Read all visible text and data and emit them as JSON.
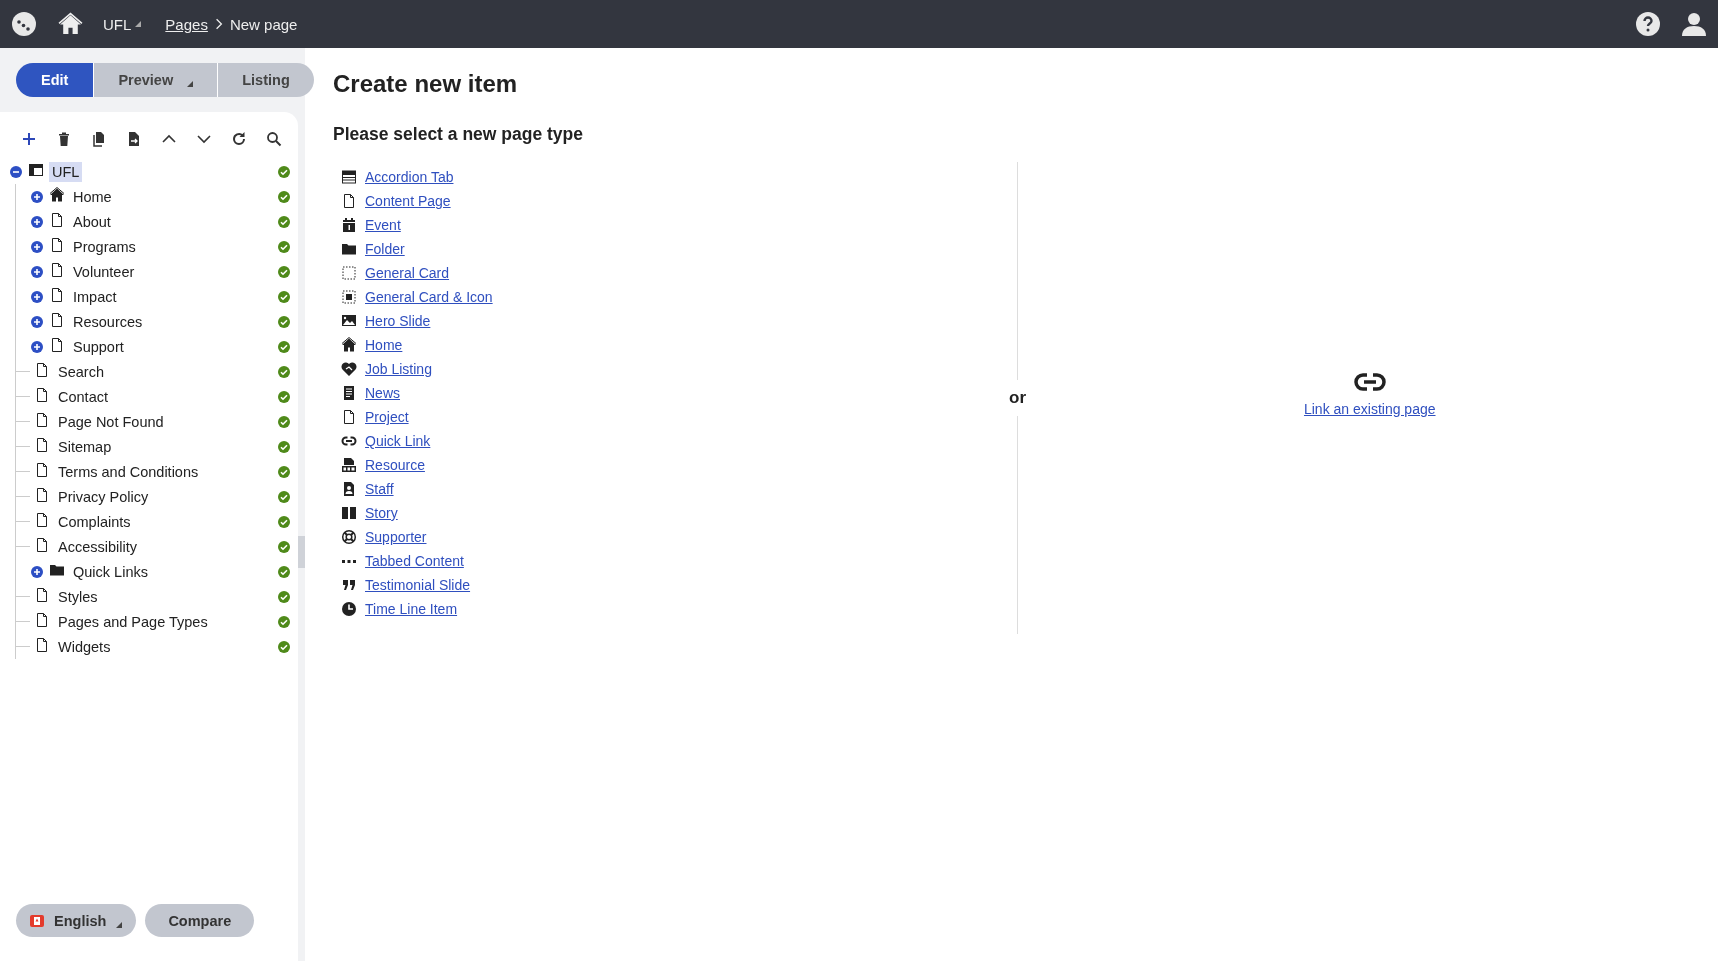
{
  "topbar": {
    "site": "UFL",
    "breadcrumb": [
      {
        "label": "Pages",
        "link": true
      },
      {
        "label": "New page",
        "link": false
      }
    ]
  },
  "mode_tabs": [
    {
      "label": "Edit",
      "selected": true,
      "dropdown": false
    },
    {
      "label": "Preview",
      "selected": false,
      "dropdown": true
    },
    {
      "label": "Listing",
      "selected": false,
      "dropdown": false
    }
  ],
  "tree": {
    "label": "UFL",
    "kind": "site",
    "expanded": true,
    "selected": true,
    "published": true,
    "children": [
      {
        "label": "Home",
        "kind": "home",
        "expandable": true,
        "expanded": false,
        "selected": false,
        "published": true
      },
      {
        "label": "About",
        "kind": "page",
        "expandable": true,
        "expanded": false,
        "selected": false,
        "published": true
      },
      {
        "label": "Programs",
        "kind": "page",
        "expandable": true,
        "expanded": false,
        "selected": false,
        "published": true
      },
      {
        "label": "Volunteer",
        "kind": "page",
        "expandable": true,
        "expanded": false,
        "selected": false,
        "published": true
      },
      {
        "label": "Impact",
        "kind": "page",
        "expandable": true,
        "expanded": false,
        "selected": false,
        "published": true
      },
      {
        "label": "Resources",
        "kind": "page",
        "expandable": true,
        "expanded": false,
        "selected": false,
        "published": true
      },
      {
        "label": "Support",
        "kind": "page",
        "expandable": true,
        "expanded": false,
        "selected": false,
        "published": true
      },
      {
        "label": "Search",
        "kind": "page",
        "expandable": false,
        "expanded": false,
        "selected": false,
        "published": true
      },
      {
        "label": "Contact",
        "kind": "page",
        "expandable": false,
        "expanded": false,
        "selected": false,
        "published": true
      },
      {
        "label": "Page Not Found",
        "kind": "page",
        "expandable": false,
        "expanded": false,
        "selected": false,
        "published": true
      },
      {
        "label": "Sitemap",
        "kind": "page",
        "expandable": false,
        "expanded": false,
        "selected": false,
        "published": true
      },
      {
        "label": "Terms and Conditions",
        "kind": "page",
        "expandable": false,
        "expanded": false,
        "selected": false,
        "published": true
      },
      {
        "label": "Privacy Policy",
        "kind": "page",
        "expandable": false,
        "expanded": false,
        "selected": false,
        "published": true
      },
      {
        "label": "Complaints",
        "kind": "page",
        "expandable": false,
        "expanded": false,
        "selected": false,
        "published": true
      },
      {
        "label": "Accessibility",
        "kind": "page",
        "expandable": false,
        "expanded": false,
        "selected": false,
        "published": true
      },
      {
        "label": "Quick Links",
        "kind": "folder",
        "expandable": true,
        "expanded": false,
        "selected": false,
        "published": true
      },
      {
        "label": "Styles",
        "kind": "page",
        "expandable": false,
        "expanded": false,
        "selected": false,
        "published": true
      },
      {
        "label": "Pages and Page Types",
        "kind": "page",
        "expandable": false,
        "expanded": false,
        "selected": false,
        "published": true
      },
      {
        "label": "Widgets",
        "kind": "page",
        "expandable": false,
        "expanded": false,
        "selected": false,
        "published": true
      }
    ]
  },
  "footer": {
    "language": "English",
    "compare": "Compare"
  },
  "main": {
    "title": "Create new item",
    "subtitle": "Please select a new page type",
    "page_types": [
      {
        "label": "Accordion Tab",
        "kind": "accordion"
      },
      {
        "label": "Content Page",
        "kind": "page"
      },
      {
        "label": "Event",
        "kind": "event"
      },
      {
        "label": "Folder",
        "kind": "folder"
      },
      {
        "label": "General Card",
        "kind": "card"
      },
      {
        "label": "General Card & Icon",
        "kind": "card_icon"
      },
      {
        "label": "Hero Slide",
        "kind": "image"
      },
      {
        "label": "Home",
        "kind": "home"
      },
      {
        "label": "Job Listing",
        "kind": "heart"
      },
      {
        "label": "News",
        "kind": "news"
      },
      {
        "label": "Project",
        "kind": "page"
      },
      {
        "label": "Quick Link",
        "kind": "link"
      },
      {
        "label": "Resource",
        "kind": "pdf"
      },
      {
        "label": "Staff",
        "kind": "staff"
      },
      {
        "label": "Story",
        "kind": "book"
      },
      {
        "label": "Supporter",
        "kind": "lifering"
      },
      {
        "label": "Tabbed Content",
        "kind": "dots"
      },
      {
        "label": "Testimonial Slide",
        "kind": "quote"
      },
      {
        "label": "Time Line Item",
        "kind": "clock"
      }
    ],
    "separator": "or",
    "existing_link": "Link an existing page"
  }
}
